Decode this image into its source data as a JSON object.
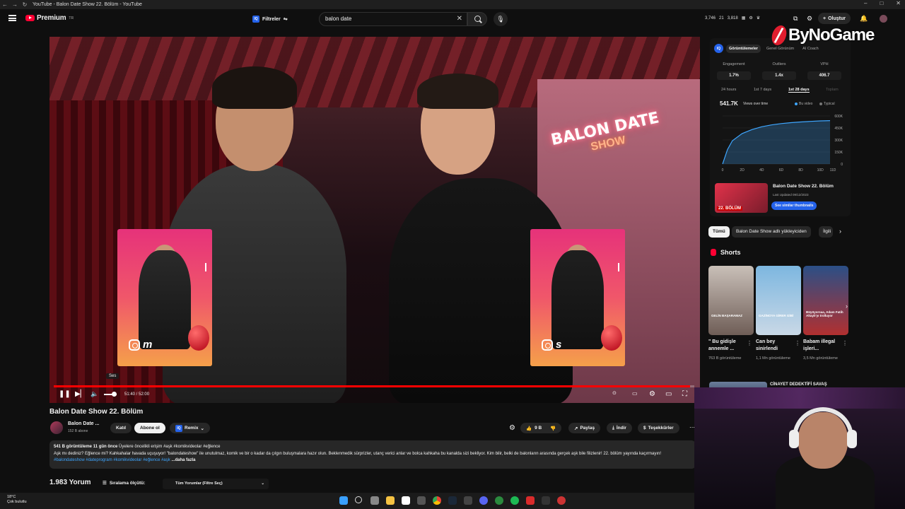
{
  "browser": {
    "tab_title": "YouTube - Balon Date Show 22. Bölüm - YouTube"
  },
  "header": {
    "logo_text": "Premium",
    "logo_badge": "TR",
    "filters_label": "Filtreler",
    "search_value": "balon date",
    "stats": [
      "3,746",
      "21",
      "3,818"
    ],
    "create_label": "Oluştur"
  },
  "watermark": {
    "text": "ByNoGame"
  },
  "video": {
    "neon_line1": "BALON DATE",
    "neon_line2": "SHOW",
    "card_left_handle": "m",
    "card_right_handle": "s",
    "tooltip": "Ses",
    "time": "51:40 / 52:00",
    "progress": 0.993
  },
  "below_video": {
    "title": "Balon Date Show 22. Bölüm",
    "channel_name": "Balon Date ...",
    "channel_subs": "152 B abone",
    "join_label": "Katıl",
    "subscribe_label": "Abone ol",
    "remix_label": "Remix",
    "likes": "9 B",
    "share_label": "Paylaş",
    "download_label": "İndir",
    "thanks_label": "Teşekkürler",
    "description": {
      "views": "541 B görüntüleme",
      "age": "11 gün önce",
      "meta": "Üyelere öncelikli erişim #aşk #komikvideolar #eğlence",
      "text": "Aşk mı dediniz? Eğlence mi? Kahkahalar havada uçuşuyor! \"balondateshow\" ile unutulmaz, komik ve bir o kadar da çılgın buluşmalara hazır olun. Beklenmedik sürprizler, utanç verici anlar ve bolca kahkaha bu kanalda sizi bekliyor. Kim bilir, belki de balonların arasında gerçek aşk bile filizlenir! 22. bölüm yayında kaçırmayın!",
      "tags": "#balondateshow #dateprogram #komikvideolar #eğlence #aşk",
      "more": "...daha fazla"
    },
    "comments_count": "1.983 Yorum",
    "sort_label": "Sıralama ölçütü:",
    "comment_filter": "Tüm Yorumlar (Filtre Seç)"
  },
  "iq_panel": {
    "badge": "IQ",
    "tabs": [
      "Görüntülemeler",
      "Genel Görünüm",
      "AI Coach"
    ],
    "metrics": [
      {
        "label": "Engagement",
        "value": "1.7%"
      },
      {
        "label": "Outliers",
        "value": "1.4x"
      },
      {
        "label": "VPH",
        "value": "406.7"
      }
    ],
    "ranges": [
      "24 hours",
      "1st 7 days",
      "1st 28 days",
      "Toplam"
    ],
    "views_total": "541.7K",
    "views_dropdown": "Views over time",
    "legend_this": "Bu video",
    "legend_typical": "Typical",
    "video_title": "Balon Date Show 22. Bölüm",
    "video_date": "Last Updated 09/12/2023",
    "similar_btn": "See similar thumbnails",
    "thumb_label": "22. BÖLÜM"
  },
  "chart_data": {
    "type": "line",
    "title": "",
    "xlabel": "",
    "ylabel": "",
    "x_ticks": [
      "0",
      "2D",
      "4D",
      "6D",
      "8D",
      "10D",
      "11D"
    ],
    "y_ticks": [
      "0",
      "150K",
      "300K",
      "450K",
      "600K"
    ],
    "ylim": [
      0,
      600000
    ],
    "series": [
      {
        "name": "Bu video",
        "x": [
          0,
          0.5,
          1,
          2,
          3,
          4,
          5,
          6,
          7,
          8,
          9,
          10,
          11
        ],
        "values": [
          0,
          180000,
          290000,
          380000,
          430000,
          465000,
          488000,
          505000,
          516000,
          525000,
          532000,
          538000,
          541700
        ]
      }
    ],
    "grid": true,
    "legend": "top-right"
  },
  "chips": [
    "Tümü",
    "Balon Date Show adlı yükleyiciden",
    "İlgili"
  ],
  "shorts": {
    "heading": "Shorts",
    "items": [
      {
        "title": "\" Bu gidişle annemle ...",
        "views": "763 B görüntüleme",
        "overlay": "GELİN BAŞARAMAZ"
      },
      {
        "title": "Can bey sinirlendi",
        "views": "1,1 Mn görüntüleme",
        "overlay": "GAZİNOYA GİRER GİBİ"
      },
      {
        "title": "Babam illegal işleri...",
        "views": "3,5 Mn görüntüleme",
        "overlay": "Büyüyorsaa, Adam Fatih Altaylı'yı trolluyor"
      }
    ]
  },
  "next_video": {
    "title": "CİNAYET DEDEKTİFİ SAVAŞ"
  },
  "taskbar": {
    "weather_temp": "18°C",
    "weather_desc": "Çok bulutlu"
  },
  "colors": {
    "accent": "#ff0033",
    "iq_blue": "#2563eb",
    "link": "#3ea6ff"
  }
}
